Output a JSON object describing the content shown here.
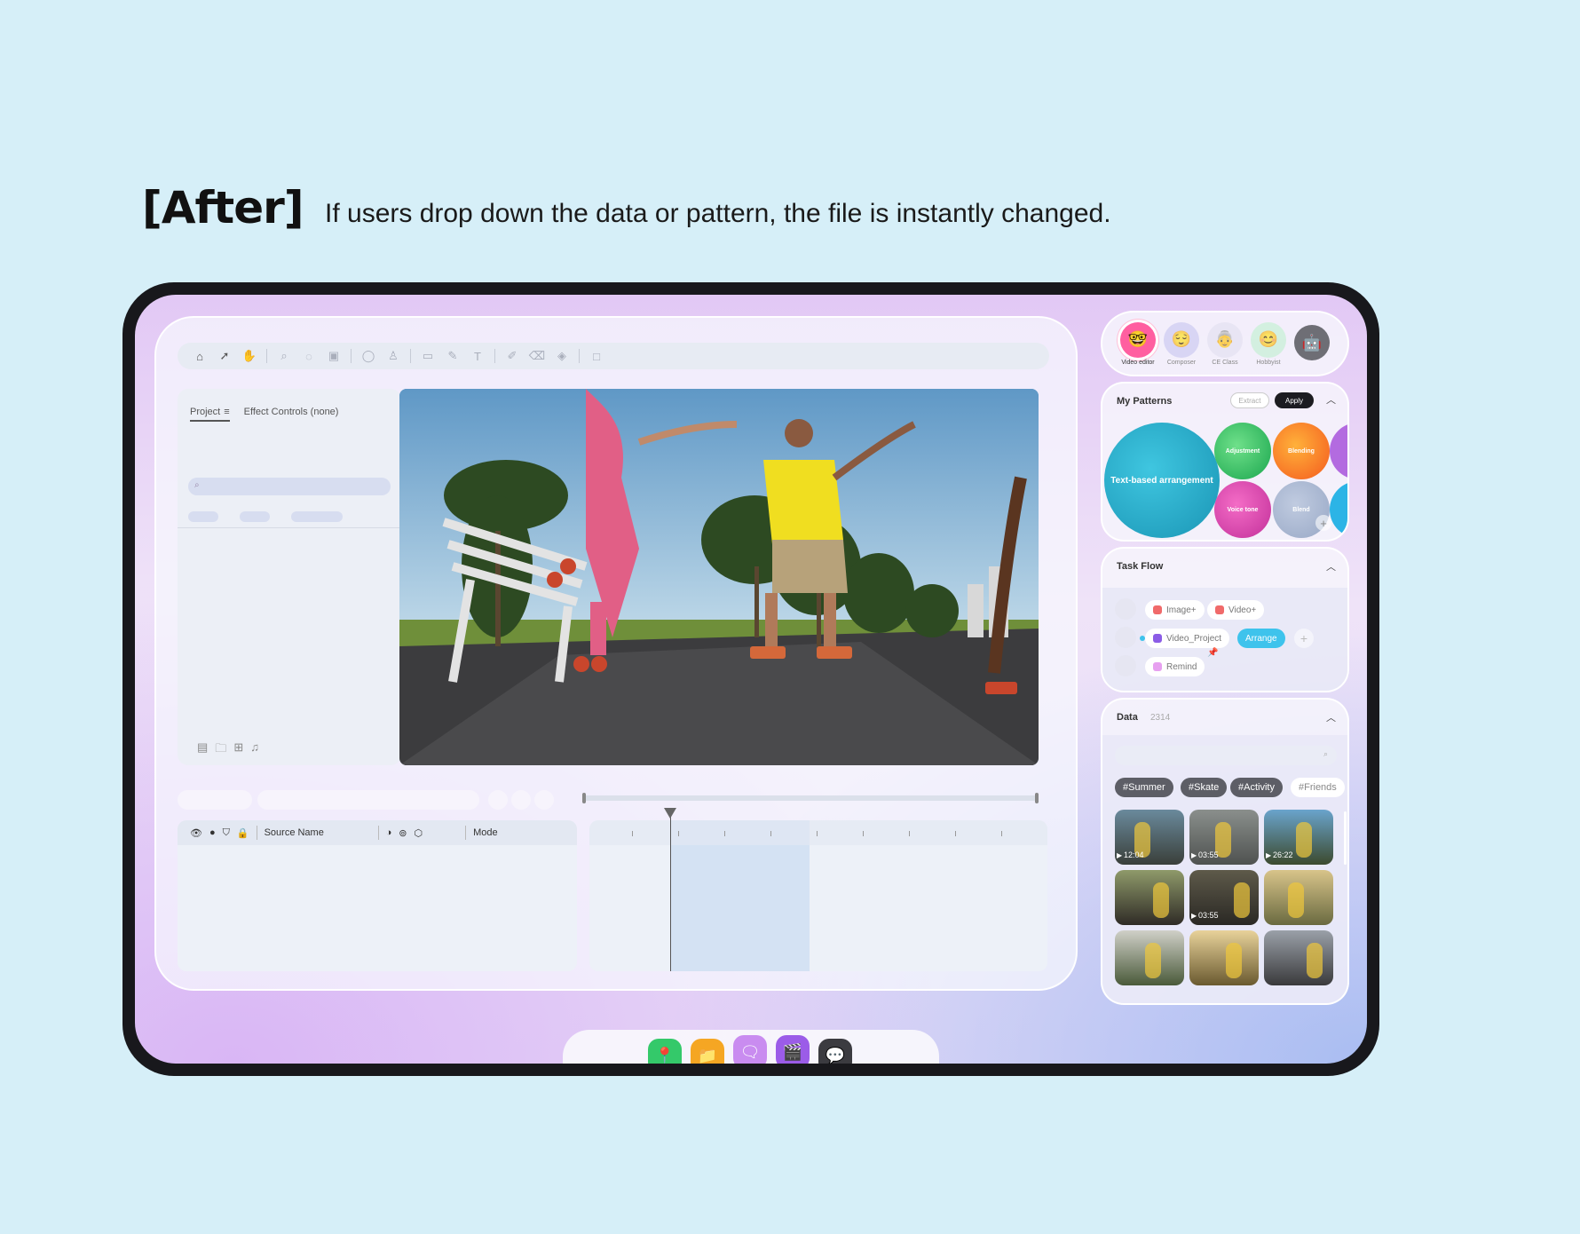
{
  "heading": "[After]",
  "subtitle": "If users drop down the data or pattern, the file is instantly changed.",
  "editor": {
    "toolbar_icons": [
      "home-icon",
      "arrow-icon",
      "hand-icon",
      "zoom-icon",
      "lasso-icon",
      "image-icon",
      "rotate-icon",
      "stamp-icon",
      "rect-icon",
      "pen-icon",
      "text-icon",
      "brush-icon",
      "eraser-icon",
      "fill-icon",
      "frame-icon"
    ],
    "project_tab": "Project",
    "effect_tab": "Effect Controls (none)",
    "layers_source_header": "Source Name",
    "layers_mode_header": "Mode"
  },
  "personas": [
    {
      "label": "Video editor",
      "emoji": "🤓",
      "color": "#ff5fa0",
      "active": true
    },
    {
      "label": "Composer",
      "emoji": "😌",
      "color": "#cfcdf2",
      "active": false
    },
    {
      "label": "CE Class",
      "emoji": "👵",
      "color": "#e5e2f2",
      "active": false
    },
    {
      "label": "Hobbyist",
      "emoji": "😊",
      "color": "#c9f0d7",
      "active": false
    },
    {
      "label": "",
      "emoji": "🤖",
      "color": "#6e6e75",
      "active": false
    }
  ],
  "patterns": {
    "title": "My Patterns",
    "extract_label": "Extract",
    "apply_label": "Apply",
    "bubbles": [
      "Text-based arrangement",
      "Adjustment",
      "Blending",
      "Voice tone",
      "Blend"
    ]
  },
  "taskflow": {
    "title": "Task Flow",
    "chips": [
      "Image+",
      "Video+",
      "Video_Project",
      "Arrange",
      "Remind"
    ],
    "add_icon": "+"
  },
  "data_panel": {
    "title": "Data",
    "count": "2314",
    "tags": [
      "#Summer",
      "#Skate",
      "#Activity",
      "#Friends"
    ],
    "durations": [
      "12:04",
      "03:55",
      "26:22",
      "",
      "03:55",
      "",
      "",
      "",
      ""
    ]
  },
  "dock_apps": [
    {
      "name": "maps-app",
      "color": "#34c96a",
      "glyph": "📍"
    },
    {
      "name": "files-app",
      "color": "#f5a623",
      "glyph": "📁"
    },
    {
      "name": "notes-app",
      "color": "#c98cf0",
      "glyph": "🗨"
    },
    {
      "name": "video-app",
      "color": "#9b5ce8",
      "glyph": "🎬"
    },
    {
      "name": "messages-app",
      "color": "#3b3b40",
      "glyph": "💬"
    }
  ]
}
